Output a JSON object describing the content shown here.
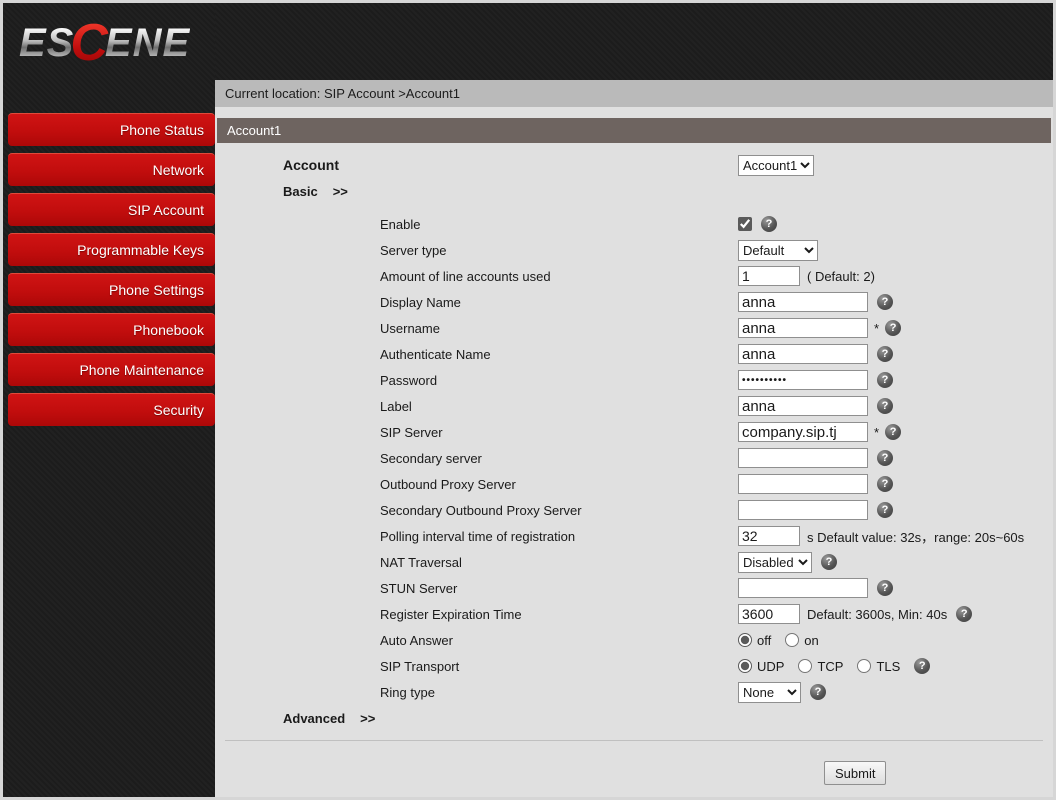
{
  "logo": {
    "part1": "ES",
    "part2": "C",
    "part3": "ENE"
  },
  "sidebar": {
    "items": [
      {
        "label": "Phone Status"
      },
      {
        "label": "Network"
      },
      {
        "label": "SIP Account"
      },
      {
        "label": "Programmable Keys"
      },
      {
        "label": "Phone Settings"
      },
      {
        "label": "Phonebook"
      },
      {
        "label": "Phone Maintenance"
      },
      {
        "label": "Security"
      }
    ]
  },
  "colors": {
    "menu_red": "#c10d0d",
    "sidebar_black": "#1d1d1d",
    "breadcrumb_gray": "#bababa",
    "section_header": "#6e6460",
    "content_bg": "#e0e0e0"
  },
  "breadcrumb": "Current location: SIP Account >Account1",
  "page": {
    "section_title": "Account1"
  },
  "icons": {
    "help": "?"
  },
  "form": {
    "account": {
      "label": "Account",
      "value": "Account1"
    },
    "basic": {
      "label": "Basic",
      "arrows": ">>"
    },
    "advanced": {
      "label": "Advanced",
      "arrows": ">>"
    },
    "fields": {
      "enable": {
        "label": "Enable",
        "checked": true
      },
      "server_type": {
        "label": "Server type",
        "value": "Default"
      },
      "line_accounts": {
        "label": "Amount of line accounts used",
        "value": "1",
        "hint": "( Default: 2)"
      },
      "display_name": {
        "label": "Display Name",
        "value": "anna"
      },
      "username": {
        "label": "Username",
        "value": "anna",
        "required_mark": "*"
      },
      "auth_name": {
        "label": "Authenticate Name",
        "value": "anna"
      },
      "password": {
        "label": "Password",
        "value": "••••••••••"
      },
      "label_field": {
        "label": "Label",
        "value": "anna"
      },
      "sip_server": {
        "label": "SIP Server",
        "value": "company.sip.tj",
        "required_mark": "*"
      },
      "secondary_server": {
        "label": "Secondary server",
        "value": ""
      },
      "outbound_proxy": {
        "label": "Outbound Proxy Server",
        "value": ""
      },
      "secondary_outbound_proxy": {
        "label": "Secondary Outbound Proxy Server",
        "value": ""
      },
      "polling_interval": {
        "label": "Polling interval time of registration",
        "value": "32",
        "hint": "s Default value: 32s，range: 20s~60s"
      },
      "nat_traversal": {
        "label": "NAT Traversal",
        "value": "Disabled"
      },
      "stun_server": {
        "label": "STUN Server",
        "value": ""
      },
      "register_expiration": {
        "label": "Register Expiration Time",
        "value": "3600",
        "hint": "Default: 3600s, Min: 40s"
      },
      "auto_answer": {
        "label": "Auto Answer",
        "options": {
          "off": "off",
          "on": "on"
        },
        "selected": "off"
      },
      "sip_transport": {
        "label": "SIP Transport",
        "options": {
          "udp": "UDP",
          "tcp": "TCP",
          "tls": "TLS"
        },
        "selected": "UDP"
      },
      "ring_type": {
        "label": "Ring type",
        "value": "None"
      }
    },
    "submit_label": "Submit"
  }
}
